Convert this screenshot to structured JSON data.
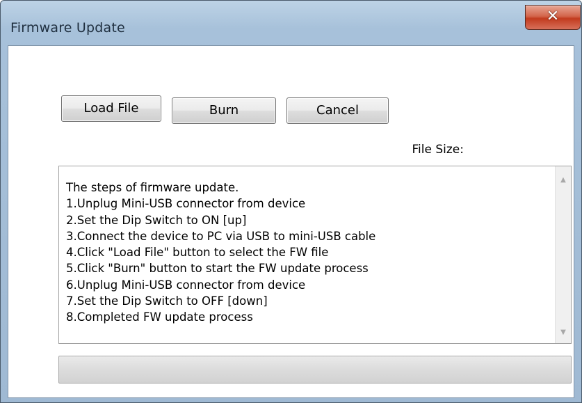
{
  "window": {
    "title": "Firmware Update",
    "close_icon": "close-icon",
    "close_glyph": "✕"
  },
  "toolbar": {
    "load_file_label": "Load File",
    "burn_label": "Burn",
    "cancel_label": "Cancel"
  },
  "file_size_label": "File Size:",
  "log": {
    "lines": [
      "The steps of firmware update.",
      "1.Unplug Mini-USB connector from device",
      "2.Set the Dip Switch to ON [up]",
      "3.Connect the device to PC via USB to mini-USB cable",
      "4.Click \"Load File\" button to select the FW file",
      "5.Click \"Burn\" button to start the FW update process",
      "6.Unplug Mini-USB connector from device",
      "7.Set the Dip Switch to OFF [down]",
      "8.Completed FW update process"
    ],
    "scroll_up_glyph": "▲",
    "scroll_down_glyph": "▼"
  },
  "progress": {
    "value": 0
  },
  "colors": {
    "titlebar": "#a7c1da",
    "close_button": "#c23b1e",
    "progress_fill": "#37b62a"
  }
}
